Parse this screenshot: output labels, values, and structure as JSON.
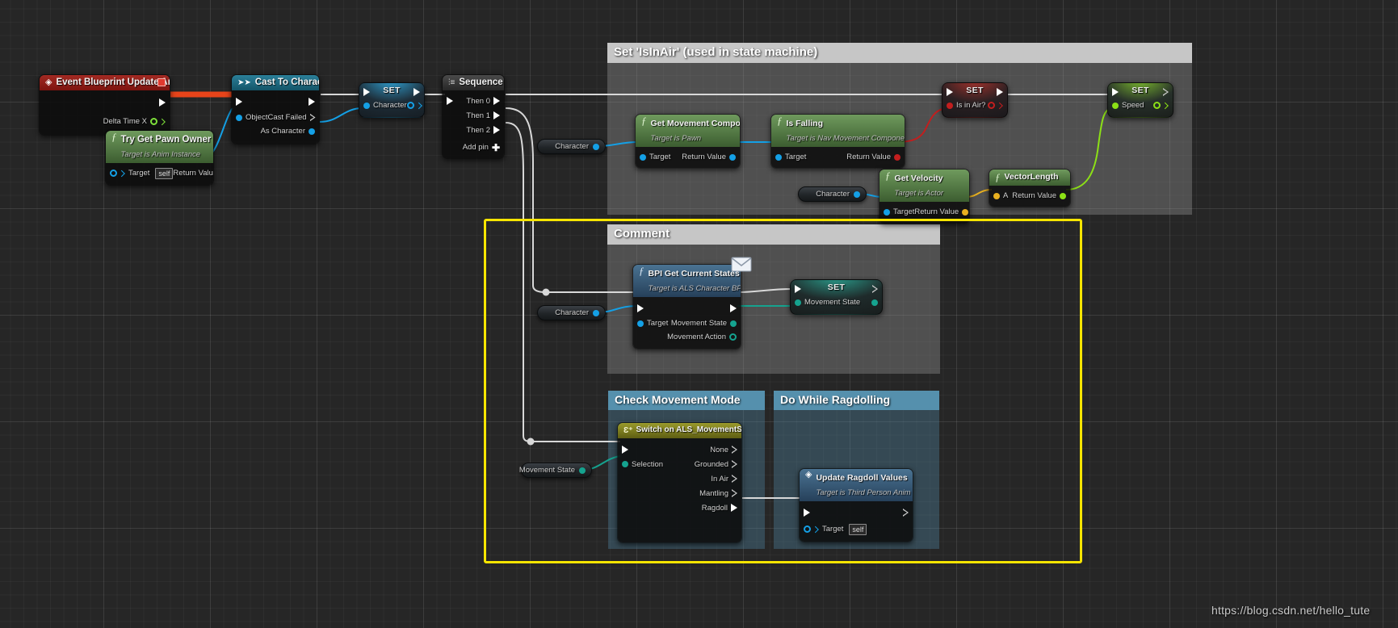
{
  "watermark": "https://blog.csdn.net/hello_tute",
  "comments": [
    {
      "id": "is-in-air",
      "title": "Set 'IsInAir' (used in state machine)"
    },
    {
      "id": "comment",
      "title": "Comment"
    },
    {
      "id": "check-movement-mode",
      "title": "Check Movement Mode"
    },
    {
      "id": "do-while-ragdolling",
      "title": "Do While Ragdolling"
    }
  ],
  "nodes": {
    "event_update_animation": {
      "title": "Event Blueprint Update Animation",
      "out_pins": [
        "Delta Time X"
      ]
    },
    "try_get_pawn_owner": {
      "title": "Try Get Pawn Owner",
      "subtitle": "Target is Anim Instance",
      "in_pins": [
        "Target"
      ],
      "in_default": "self",
      "out_pins": [
        "Return Value"
      ]
    },
    "cast_to_character": {
      "title": "Cast To Character",
      "in_pins": [
        "Object"
      ],
      "out_pins": [
        "Cast Failed",
        "As Character"
      ]
    },
    "set_character": {
      "title": "SET",
      "in_pins": [
        "Character"
      ]
    },
    "sequence": {
      "title": "Sequence",
      "out_pins": [
        "Then 0",
        "Then 1",
        "Then 2"
      ],
      "add_pin": "Add pin"
    },
    "get_movement_component": {
      "title": "Get Movement Component",
      "subtitle": "Target is Pawn",
      "in_pins": [
        "Target"
      ],
      "out_pins": [
        "Return Value"
      ]
    },
    "is_falling": {
      "title": "Is Falling",
      "subtitle": "Target is Nav Movement Component",
      "in_pins": [
        "Target"
      ],
      "out_pins": [
        "Return Value"
      ]
    },
    "set_is_in_air": {
      "title": "SET",
      "in_pins": [
        "Is in Air?"
      ]
    },
    "get_velocity": {
      "title": "Get Velocity",
      "subtitle": "Target is Actor",
      "in_pins": [
        "Target"
      ],
      "out_pins": [
        "Return Value"
      ]
    },
    "vector_length": {
      "title": "VectorLength",
      "in_pins": [
        "A"
      ],
      "out_pins": [
        "Return Value"
      ]
    },
    "set_speed": {
      "title": "SET",
      "in_pins": [
        "Speed"
      ]
    },
    "bpi_get_current_states": {
      "title": "BPI Get Current States",
      "subtitle": "Target is ALS Character BPI",
      "in_pins": [
        "Target"
      ],
      "out_pins": [
        "Movement State",
        "Movement Action"
      ]
    },
    "set_movement_state": {
      "title": "SET",
      "in_pins": [
        "Movement State"
      ]
    },
    "switch_on_als_movementstate": {
      "title": "Switch on ALS_MovementState",
      "in_pins": [
        "Selection"
      ],
      "out_pins": [
        "None",
        "Grounded",
        "In Air",
        "Mantling",
        "Ragdoll"
      ]
    },
    "update_ragdoll_values": {
      "title": "Update Ragdoll Values",
      "subtitle": "Target is Third Person Anim BP",
      "in_pins": [
        "Target"
      ],
      "in_default": "self"
    }
  },
  "variables": [
    {
      "id": "character-1",
      "label": "Character"
    },
    {
      "id": "character-2",
      "label": "Character"
    },
    {
      "id": "character-3",
      "label": "Character"
    },
    {
      "id": "movement-state",
      "label": "Movement State"
    }
  ],
  "colors": {
    "exec_wire": "#d8d8d8",
    "object_wire": "#14a0e6",
    "bool_wire": "#c31e1e",
    "vector_wire": "#e8b020",
    "float_wire": "#8ce016",
    "enum_wire": "#15a38f",
    "event_red": "#8e1411",
    "function_green": "#477a3b",
    "cast_teal": "#1b6e84",
    "comment_grey": "#a8a8a8",
    "comment_blue": "#4f87a6",
    "selection_yellow": "#f6e500",
    "switch_olive": "#7a7a1d"
  }
}
